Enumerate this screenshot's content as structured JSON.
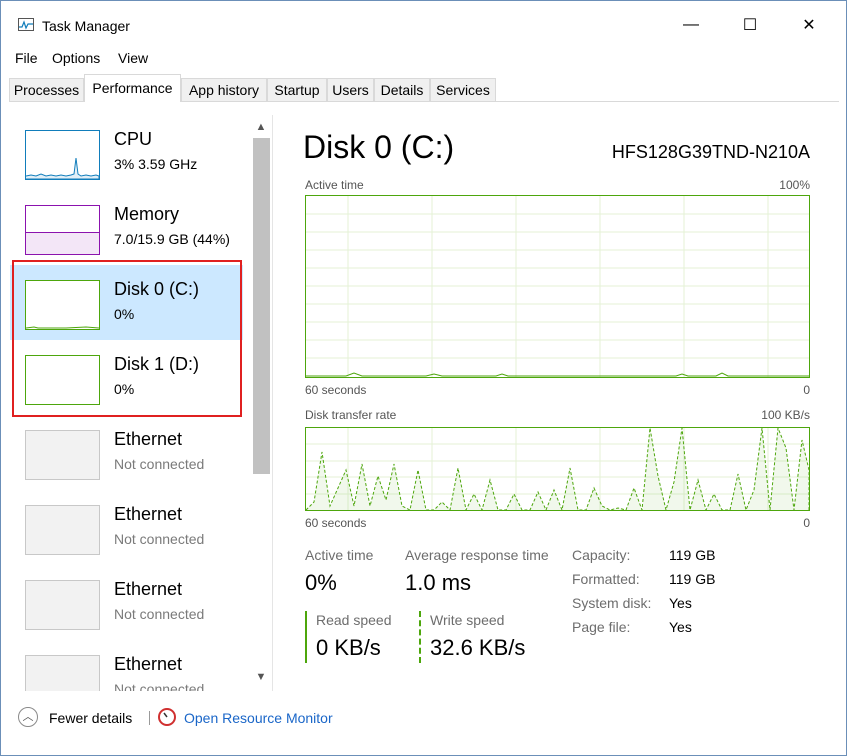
{
  "window": {
    "title": "Task Manager",
    "controls": {
      "minimize": "—",
      "maximize": "☐",
      "close": "✕"
    }
  },
  "menu": [
    "File",
    "Options",
    "View"
  ],
  "tabs": [
    "Processes",
    "Performance",
    "App history",
    "Startup",
    "Users",
    "Details",
    "Services"
  ],
  "active_tab": "Performance",
  "resources": [
    {
      "name": "CPU",
      "detail": "3%  3.59 GHz",
      "color": "#117dbb"
    },
    {
      "name": "Memory",
      "detail": "7.0/15.9 GB (44%)",
      "color": "#8b12ae"
    },
    {
      "name": "Disk 0 (C:)",
      "detail": "0%",
      "color": "#4da60c",
      "selected": true
    },
    {
      "name": "Disk 1 (D:)",
      "detail": "0%",
      "color": "#4da60c"
    },
    {
      "name": "Ethernet",
      "detail": "Not connected",
      "color": "#a0a0a0"
    },
    {
      "name": "Ethernet",
      "detail": "Not connected",
      "color": "#a0a0a0"
    },
    {
      "name": "Ethernet",
      "detail": "Not connected",
      "color": "#a0a0a0"
    },
    {
      "name": "Ethernet",
      "detail": "Not connected",
      "color": "#a0a0a0"
    }
  ],
  "detail": {
    "title": "Disk 0 (C:)",
    "model": "HFS128G39TND-N210A",
    "graph1": {
      "label": "Active time",
      "max": "100%",
      "time": "60 seconds",
      "min": "0"
    },
    "graph2": {
      "label": "Disk transfer rate",
      "max": "100 KB/s",
      "time": "60 seconds",
      "min": "0"
    },
    "active_time_label": "Active time",
    "active_time_value": "0%",
    "avg_response_label": "Average response time",
    "avg_response_value": "1.0 ms",
    "read_label": "Read speed",
    "read_value": "0 KB/s",
    "write_label": "Write speed",
    "write_value": "32.6 KB/s",
    "props": [
      {
        "label": "Capacity:",
        "value": "119 GB"
      },
      {
        "label": "Formatted:",
        "value": "119 GB"
      },
      {
        "label": "System disk:",
        "value": "Yes"
      },
      {
        "label": "Page file:",
        "value": "Yes"
      }
    ]
  },
  "footer": {
    "fewer_details": "Fewer details",
    "open_resource_monitor": "Open Resource Monitor"
  },
  "accent_color": "#4da60c",
  "highlight_color": "#e02020"
}
